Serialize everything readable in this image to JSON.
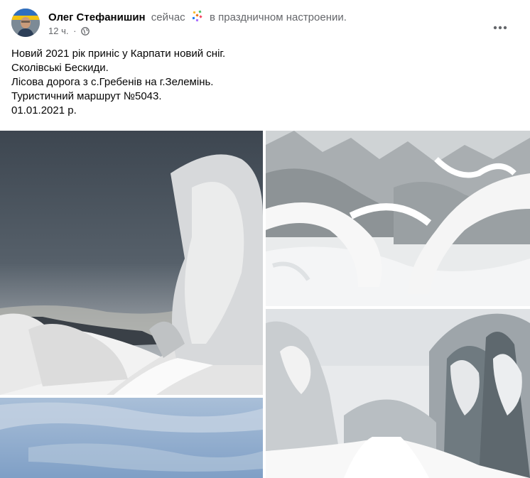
{
  "post": {
    "author": "Олег Стефанишин",
    "feeling_prefix": "сейчас",
    "feeling_text": "в праздничном настроении.",
    "time": "12 ч.",
    "separator": "·",
    "privacy_icon": "globe-icon",
    "feeling_icon": "confetti-icon",
    "menu_icon": "more-horizontal-icon",
    "text_lines": [
      "Новий 2021 рік приніс у Карпати новий сніг.",
      "Сколівські Бескиди.",
      "Лісова дорога з с.Гребенів на г.Зелемінь.",
      "Туристичний маршрут №5043.",
      "01.01.2021 р."
    ],
    "photos": [
      {
        "alt": "snow-road-cloudy-sky"
      },
      {
        "alt": "snow-bent-trees"
      },
      {
        "alt": "snow-forest-trail"
      },
      {
        "alt": "blue-winter-sky"
      }
    ]
  },
  "colors": {
    "primary_text": "#050505",
    "secondary_text": "#65676b",
    "background": "#ffffff"
  }
}
